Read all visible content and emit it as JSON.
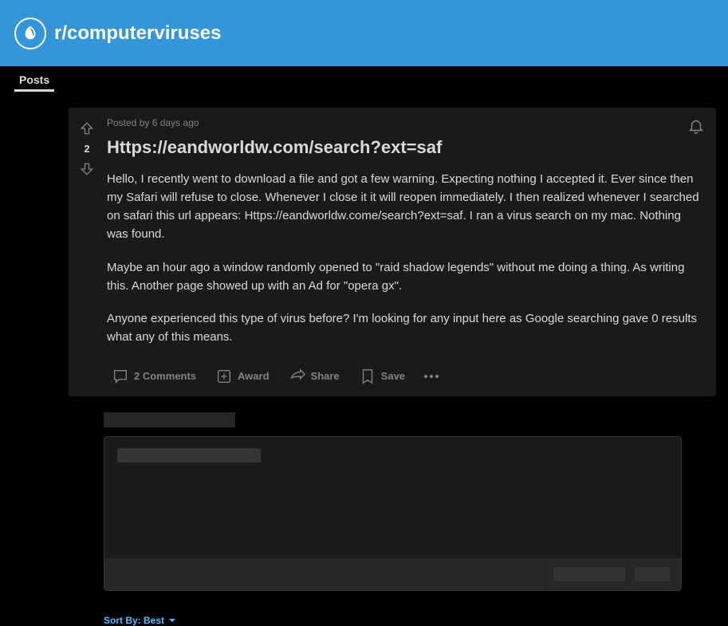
{
  "banner": {
    "subreddit": "r/computerviruses"
  },
  "tabs": {
    "posts": "Posts"
  },
  "post": {
    "meta": "Posted by 6 days ago",
    "score": "2",
    "title": "Https://eandworldw.com/search?ext=saf",
    "p1": "Hello, I recently went to download a file and got a few warning. Expecting nothing I accepted it. Ever since then my Safari will refuse to close. Whenever I close it it will reopen immediately. I then realized whenever I searched on safari this url appears: Https://eandworldw.come/search?ext=saf. I ran a virus search on my mac. Nothing was found.",
    "p2": "Maybe an hour ago a window randomly opened to \"raid shadow legends\" without me doing a thing. As writing this. Another page showed up with an Ad for \"opera gx\".",
    "p3": "Anyone experienced this type of virus before? I'm looking for any input here as Google searching gave 0 results what any of this means."
  },
  "actions": {
    "comments": "2 Comments",
    "award": "Award",
    "share": "Share",
    "save": "Save"
  },
  "sort": {
    "label": "Sort By: Best"
  }
}
